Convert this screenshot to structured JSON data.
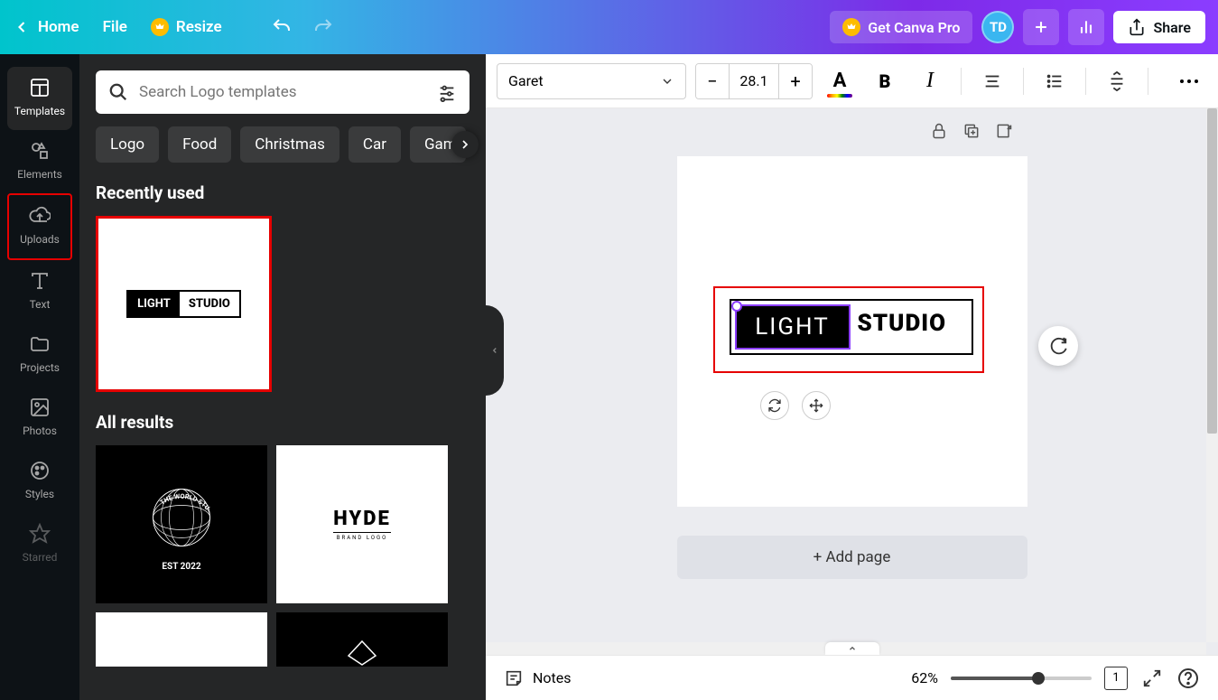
{
  "header": {
    "home": "Home",
    "file": "File",
    "resize": "Resize",
    "pro": "Get Canva Pro",
    "avatar": "TD",
    "share": "Share"
  },
  "rail": {
    "templates": "Templates",
    "elements": "Elements",
    "uploads": "Uploads",
    "text": "Text",
    "projects": "Projects",
    "photos": "Photos",
    "styles": "Styles",
    "starred": "Starred"
  },
  "panel": {
    "search_placeholder": "Search Logo templates",
    "chips": [
      "Logo",
      "Food",
      "Christmas",
      "Car",
      "Gaming"
    ],
    "recently_used": "Recently used",
    "all_results": "All results",
    "recent_logo": {
      "left": "LIGHT",
      "right": "STUDIO"
    },
    "result1": {
      "line1": "THE WORLD STUDIOS",
      "line2": "EST 2022"
    },
    "result2": {
      "title": "HYDE",
      "sub": "BRAND LOGO"
    }
  },
  "toolbar": {
    "font": "Garet",
    "font_size": "28.1"
  },
  "canvas": {
    "text_light": "LIGHT",
    "text_studio": "STUDIO",
    "add_page": "+ Add page"
  },
  "footer": {
    "notes": "Notes",
    "zoom": "62%",
    "page_count": "1"
  }
}
